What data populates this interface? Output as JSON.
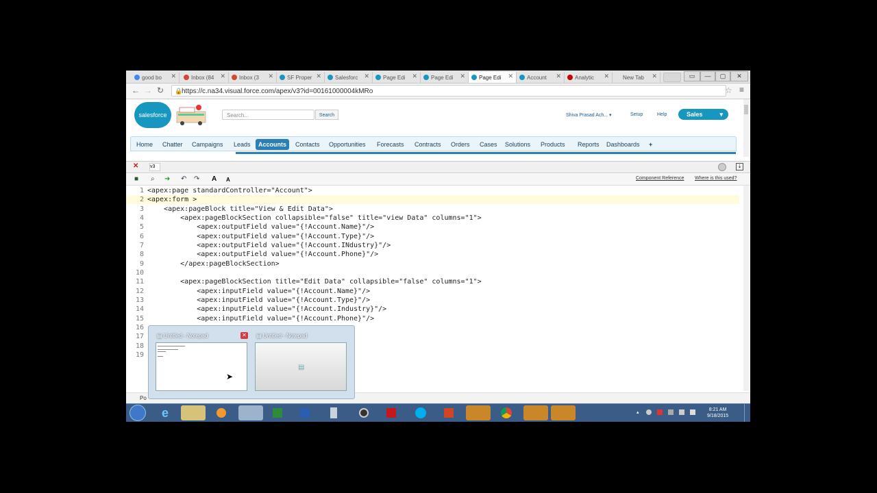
{
  "browser": {
    "tabs": [
      {
        "label": "good bo",
        "color": "#4285f4"
      },
      {
        "label": "Inbox (84",
        "color": "#d14836"
      },
      {
        "label": "Inbox (3",
        "color": "#d14836"
      },
      {
        "label": "SF Proper",
        "color": "#1797c0"
      },
      {
        "label": "Salesforc",
        "color": "#1797c0"
      },
      {
        "label": "Page Edi",
        "color": "#1797c0"
      },
      {
        "label": "Page Edi",
        "color": "#1797c0"
      },
      {
        "label": "Page Edi",
        "color": "#1797c0"
      },
      {
        "label": "Account",
        "color": "#1797c0"
      },
      {
        "label": "Analytic",
        "color": "#cc0000"
      },
      {
        "label": "New Tab",
        "color": "#cccccc"
      }
    ],
    "url": "https://c.na34.visual.force.com/apex/v3?id=00161000004kMRo"
  },
  "salesforce": {
    "logo": "salesforce",
    "search_placeholder": "Search...",
    "search_button": "Search",
    "user": "Shiva Prasad Ach...",
    "setup": "Setup",
    "help": "Help",
    "app": "Sales",
    "nav": [
      "Home",
      "Chatter",
      "Campaigns",
      "Leads",
      "Accounts",
      "Contacts",
      "Opportunities",
      "Forecasts",
      "Contracts",
      "Orders",
      "Cases",
      "Solutions",
      "Products",
      "Reports",
      "Dashboards",
      "+"
    ]
  },
  "dev": {
    "page_name": "v3",
    "component_reference": "Component Reference",
    "where_used": "Where is this used?",
    "status_prefix": "Po"
  },
  "editor": {
    "lines": [
      {
        "n": "1",
        "code": "<apex:page standardController=\"Account\">"
      },
      {
        "n": "2",
        "code": "<apex:form >"
      },
      {
        "n": "3",
        "code": "    <apex:pageBlock title=\"View & Edit Data\">"
      },
      {
        "n": "4",
        "code": "        <apex:pageBlockSection collapsible=\"false\" title=\"view Data\" columns=\"1\">"
      },
      {
        "n": "5",
        "code": "            <apex:outputField value=\"{!Account.Name}\"/>"
      },
      {
        "n": "6",
        "code": "            <apex:outputField value=\"{!Account.Type}\"/>"
      },
      {
        "n": "7",
        "code": "            <apex:outputField value=\"{!Account.INdustry}\"/>"
      },
      {
        "n": "8",
        "code": "            <apex:outputField value=\"{!Account.Phone}\"/>"
      },
      {
        "n": "9",
        "code": "        </apex:pageBlockSection>"
      },
      {
        "n": "10",
        "code": ""
      },
      {
        "n": "11",
        "code": "        <apex:pageBlockSection title=\"Edit Data\" collapsible=\"false\" columns=\"1\">"
      },
      {
        "n": "12",
        "code": "            <apex:inputField value=\"{!Account.Name}\"/>"
      },
      {
        "n": "13",
        "code": "            <apex:inputField value=\"{!Account.Type}\"/>"
      },
      {
        "n": "14",
        "code": "            <apex:inputField value=\"{!Account.Industry}\"/>"
      },
      {
        "n": "15",
        "code": "            <apex:inputField value=\"{!Account.Phone}\"/>"
      },
      {
        "n": "16",
        "code": ""
      },
      {
        "n": "17",
        "code": ""
      },
      {
        "n": "18",
        "code": ""
      },
      {
        "n": "19",
        "code": ""
      }
    ]
  },
  "preview": {
    "window1": "Untitled - Notepad",
    "window2": "Untitled - Notepad"
  },
  "taskbar": {
    "time": "8:21 AM",
    "date": "9/18/2015"
  }
}
